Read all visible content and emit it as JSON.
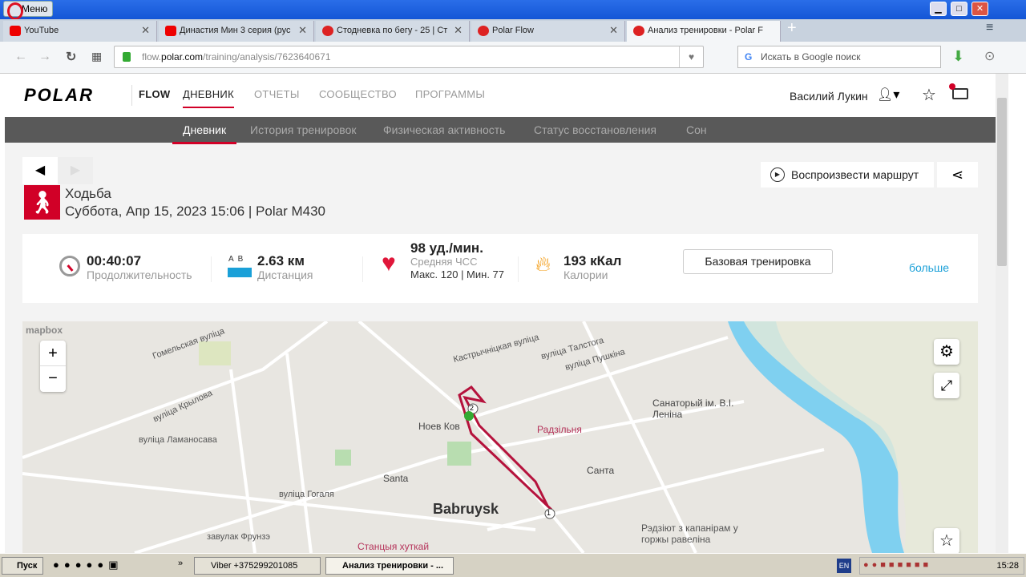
{
  "window": {
    "menu": "Меню",
    "minimize": "▁",
    "maximize": "□",
    "close": "✕"
  },
  "tabs": [
    {
      "label": "YouTube"
    },
    {
      "label": "Династия Мин 3 серия (рус"
    },
    {
      "label": "Стодневка по бегу - 25 | Ст"
    },
    {
      "label": "Polar Flow"
    },
    {
      "label": "Анализ тренировки - Polar F"
    }
  ],
  "new_tab": "+",
  "address": {
    "host_pre": "flow.",
    "host": "polar.com",
    "path": "/training/analysis/7623640671"
  },
  "search_placeholder": "Искать в Google поиск",
  "header": {
    "logo": "POLAR",
    "flow": "FLOW",
    "nav": [
      "ДНЕВНИК",
      "ОТЧЕТЫ",
      "СООБЩЕСТВО",
      "ПРОГРАММЫ"
    ],
    "user": "Василий Лукин"
  },
  "subnav": [
    "Дневник",
    "История тренировок",
    "Физическая активность",
    "Статус восстановления",
    "Сон"
  ],
  "training": {
    "sport": "Ходьба",
    "datetime": "Суббота, Апр 15, 2023 15:06 | Polar M430",
    "play_route": "Воспроизвести маршрут"
  },
  "stats": {
    "duration": "00:40:07",
    "duration_label": "Продолжительность",
    "ab": "A  B",
    "distance": "2.63 км",
    "distance_label": "Дистанция",
    "hr": "98 уд./мин.",
    "hr_label": "Средняя ЧСС",
    "hr_minmax": "Макс. 120 | Мин. 77",
    "calories": "193 кКал",
    "calories_label": "Калории",
    "base_training": "Базовая тренировка",
    "more": "больше"
  },
  "map": {
    "attribution": "mapbox",
    "zoom_in": "+",
    "zoom_out": "−",
    "labels": [
      "Гомельская вуліца",
      "вуліца Крылова",
      "вуліца Ламаносава",
      "вуліца Гогаля",
      "вуліца Талстога",
      "вуліца Пушкіна",
      "Кастрычніцкая вуліца",
      "Ноев Ков",
      "Радзільня",
      "Санаторый ім. В.І. Леніна",
      "Santa",
      "Санта",
      "Babruysk",
      "Рэдзіют з капанірам у горжы равеліна",
      "Станцыя хуткай",
      "завулак Фрунзэ"
    ],
    "markers": [
      "1",
      "2"
    ]
  },
  "taskbar": {
    "start": "Пуск",
    "items": [
      "Viber +375299201085",
      "Анализ тренировки - ..."
    ],
    "lang": "EN",
    "time": "15:28",
    "more": "»"
  }
}
